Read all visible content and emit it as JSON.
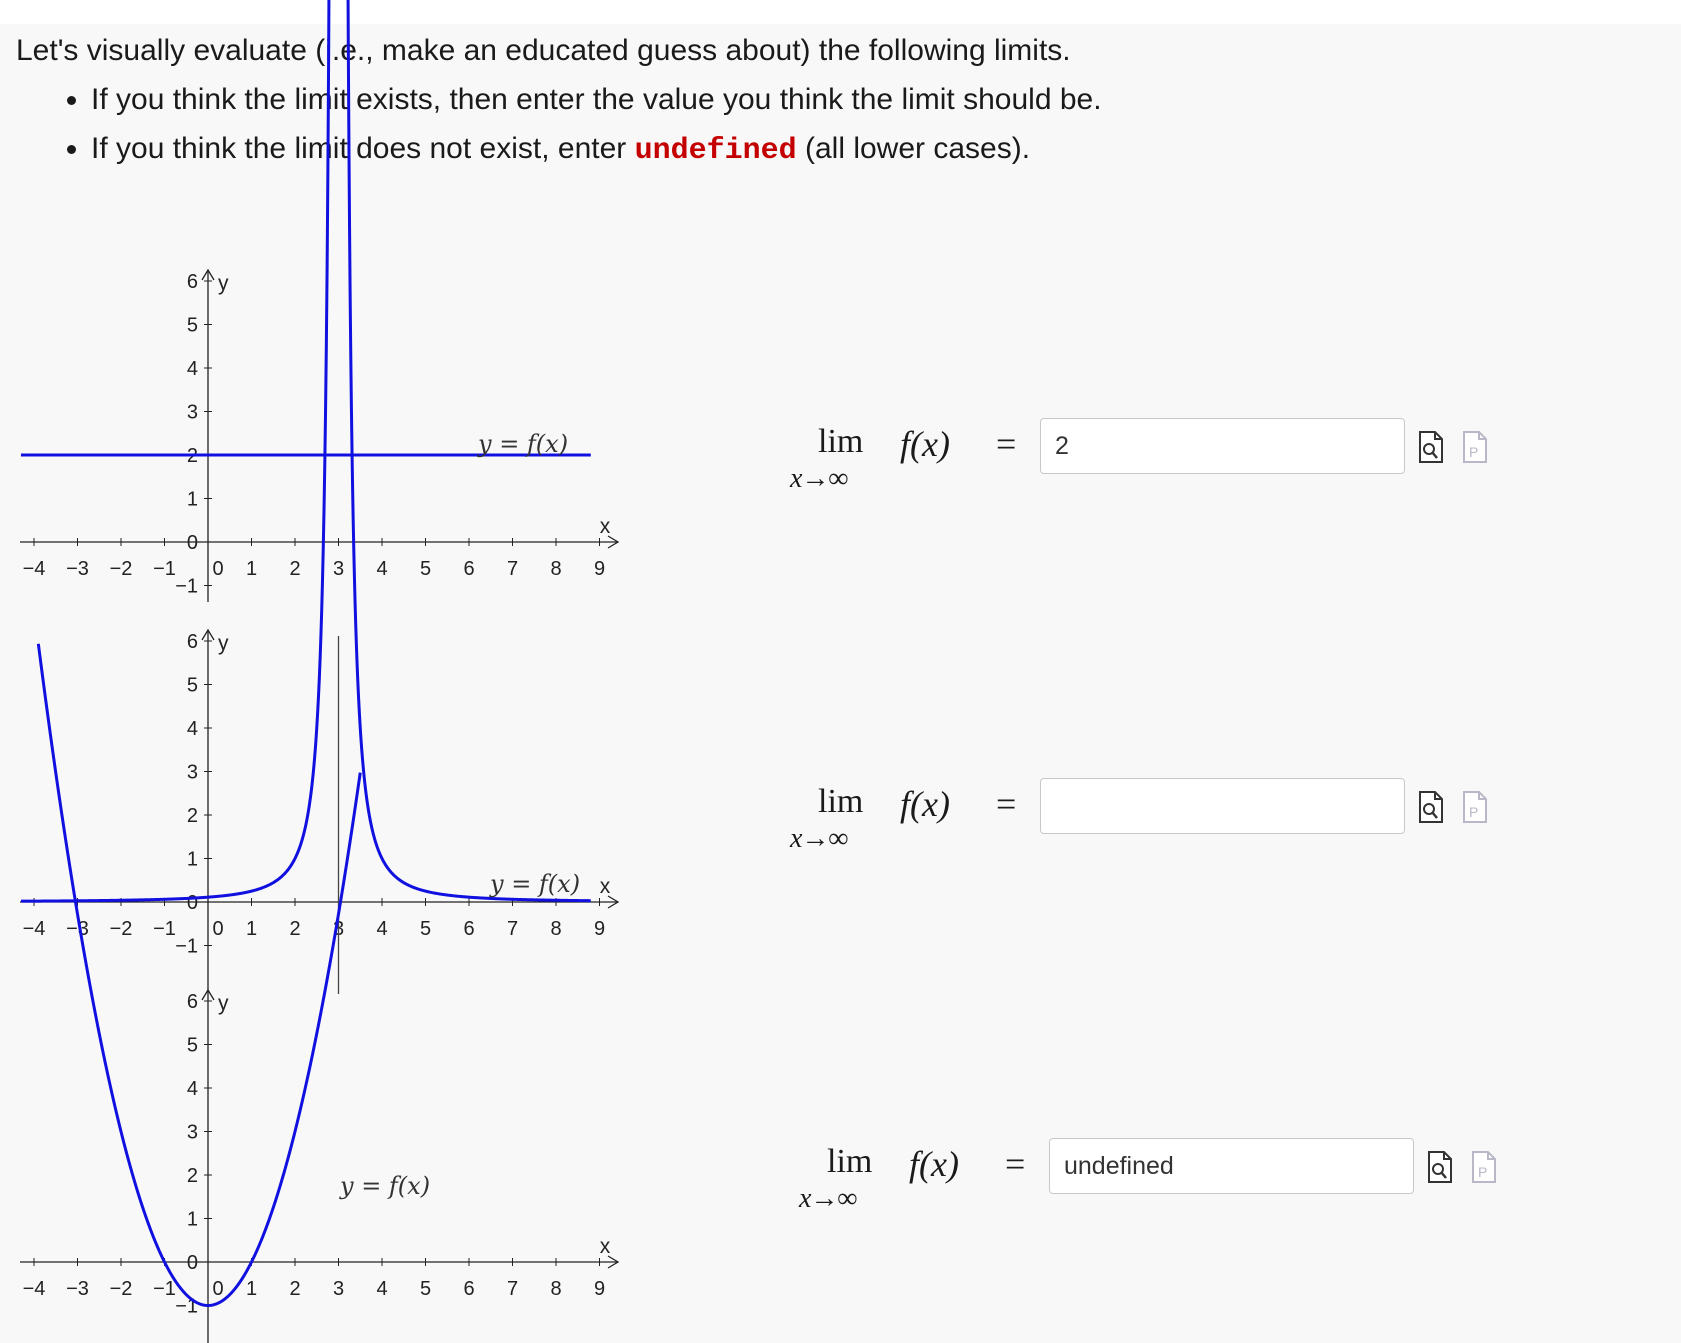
{
  "intro": {
    "line1": "Let's visually evaluate (i.e., make an educated guess about) the following limits.",
    "bullet1": "If you think the limit exists, then enter the value you think the limit should be.",
    "bullet2_pre": "If you think the limit does not exist, enter ",
    "bullet2_code": "undefined",
    "bullet2_post": " (all lower cases)."
  },
  "axes": {
    "x_ticks": [
      "-4",
      "-3",
      "-2",
      "-1",
      "0",
      "1",
      "2",
      "3",
      "4",
      "5",
      "6",
      "7",
      "8",
      "9"
    ],
    "y_ticks": [
      "-1",
      "0",
      "1",
      "2",
      "3",
      "4",
      "5",
      "6"
    ],
    "x_label": "x",
    "y_label": "y"
  },
  "problems": [
    {
      "curve_label": "y = f(x)",
      "limit_word": "lim",
      "limit_sub": "x→∞",
      "expression": "f(x)",
      "equals": "=",
      "answer_value": "2",
      "graph": {
        "type": "constant",
        "value": 2
      }
    },
    {
      "curve_label": "y = f(x)",
      "limit_word": "lim",
      "limit_sub": "x→∞",
      "expression": "f(x)",
      "equals": "=",
      "answer_value": "",
      "graph": {
        "type": "vertical_asymptote",
        "asymptote_x": 3
      }
    },
    {
      "curve_label": "y = f(x)",
      "limit_word": "lim",
      "limit_sub": "x→∞",
      "expression": "f(x)",
      "equals": "=",
      "answer_value": "undefined",
      "graph": {
        "type": "parabola",
        "vertex": [
          0,
          -1
        ],
        "roots": [
          -1,
          1
        ]
      }
    }
  ],
  "colors": {
    "curve": "#1010e0",
    "code": "#c40000",
    "axis": "#222222"
  },
  "icons": [
    "preview-icon",
    "pdf-icon"
  ]
}
